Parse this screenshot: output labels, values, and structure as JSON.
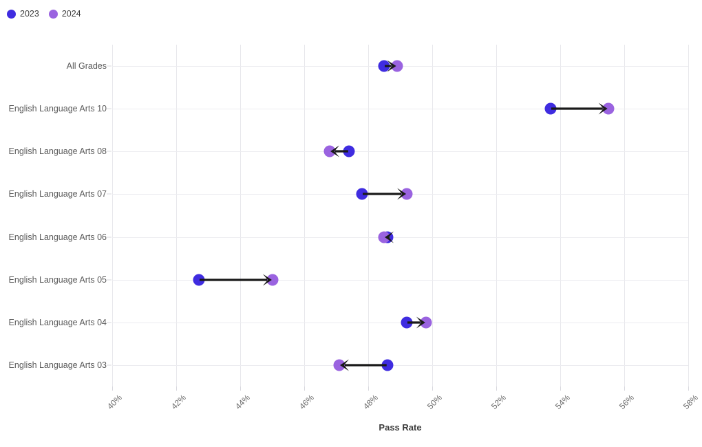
{
  "legend": {
    "position": "top-left",
    "items": [
      {
        "label": "2023",
        "color": "#3f2ce0",
        "icon": "circle-marker-icon"
      },
      {
        "label": "2024",
        "color": "#9a63e0",
        "icon": "circle-marker-icon"
      }
    ]
  },
  "axis": {
    "x_title": "Pass Rate",
    "y_title": ""
  },
  "chart_data": {
    "type": "scatter",
    "subtype": "dumbbell-arrow",
    "title": "",
    "subtitle": "",
    "xlabel": "Pass Rate",
    "ylabel": "",
    "xlim": [
      39.5,
      58.5
    ],
    "grid": true,
    "legend_position": "top-left",
    "xticks": [
      40,
      42,
      44,
      46,
      48,
      50,
      52,
      54,
      56,
      58
    ],
    "xticklabels": [
      "40%",
      "42%",
      "44%",
      "46%",
      "48%",
      "50%",
      "52%",
      "54%",
      "56%",
      "58%"
    ],
    "categories": [
      "All Grades",
      "English Language Arts 10",
      "English Language Arts 08",
      "English Language Arts 07",
      "English Language Arts 06",
      "English Language Arts 05",
      "English Language Arts 04",
      "English Language Arts 03"
    ],
    "series": [
      {
        "name": "2023",
        "color": "#3f2ce0",
        "values": [
          48.5,
          53.7,
          47.4,
          47.8,
          48.6,
          42.7,
          49.2,
          48.6
        ]
      },
      {
        "name": "2024",
        "color": "#9a63e0",
        "values": [
          48.9,
          55.5,
          46.8,
          49.2,
          48.5,
          45.0,
          49.8,
          47.1
        ]
      }
    ],
    "annotations": [
      {
        "category": "All Grades",
        "direction": "increase"
      },
      {
        "category": "English Language Arts 10",
        "direction": "increase"
      },
      {
        "category": "English Language Arts 08",
        "direction": "decrease"
      },
      {
        "category": "English Language Arts 07",
        "direction": "increase"
      },
      {
        "category": "English Language Arts 06",
        "direction": "decrease"
      },
      {
        "category": "English Language Arts 05",
        "direction": "increase"
      },
      {
        "category": "English Language Arts 04",
        "direction": "increase"
      },
      {
        "category": "English Language Arts 03",
        "direction": "decrease"
      }
    ]
  },
  "colors": {
    "series_2023": "#3f2ce0",
    "series_2024": "#9a63e0",
    "arrow": "#1a1a1a",
    "grid": "#e8e8ec",
    "text": "#5a5a5a"
  }
}
